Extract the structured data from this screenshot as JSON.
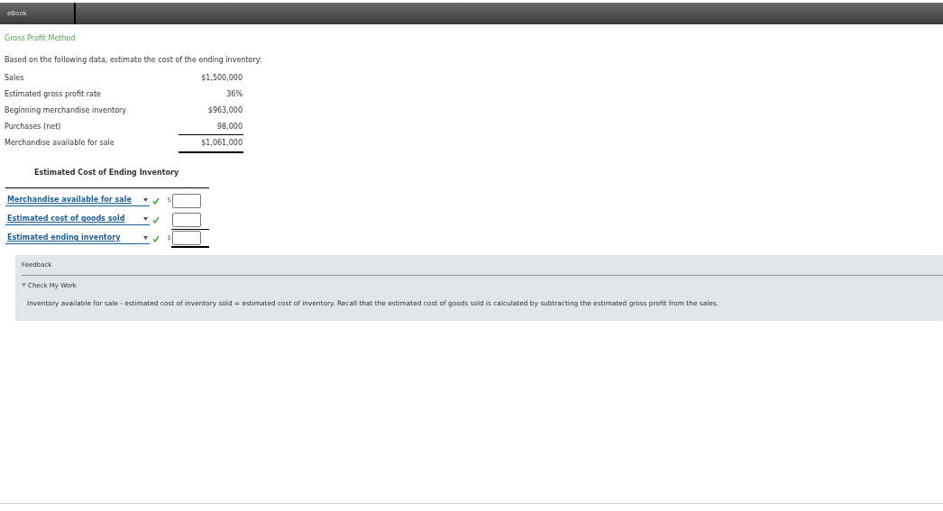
{
  "tab": {
    "label": "eBook"
  },
  "title": "Gross Profit Method",
  "intro": "Based on the following data, estimate the cost of the ending inventory:",
  "data_rows": [
    {
      "label": "Sales",
      "value": "$1,500,000",
      "total": false
    },
    {
      "label": "Estimated gross profit rate",
      "value": "36%",
      "total": false
    },
    {
      "label": "Beginning merchandise inventory",
      "value": "$963,000",
      "total": false
    },
    {
      "label": "Purchases (net)",
      "value": "98,000",
      "total": false
    },
    {
      "label": "Merchandise available for sale",
      "value": "$1,061,000",
      "total": true
    }
  ],
  "answer_title": "Estimated Cost of Ending Inventory",
  "answer_rows": [
    {
      "selection": "Merchandise available for sale",
      "correct": true,
      "currency": "$",
      "total": false
    },
    {
      "selection": "Estimated cost of goods sold",
      "correct": true,
      "total": false
    },
    {
      "selection": "Estimated ending inventory",
      "correct": true,
      "currency": "$",
      "total": true
    }
  ],
  "feedback": {
    "title": "Feedback",
    "section": "Check My Work",
    "expanded": true,
    "text": "Inventory available for sale - estimated cost of inventory sold = estimated cost of inventory. Recall that the estimated cost of goods sold is calculated by subtracting the estimated gross profit from the sales."
  }
}
